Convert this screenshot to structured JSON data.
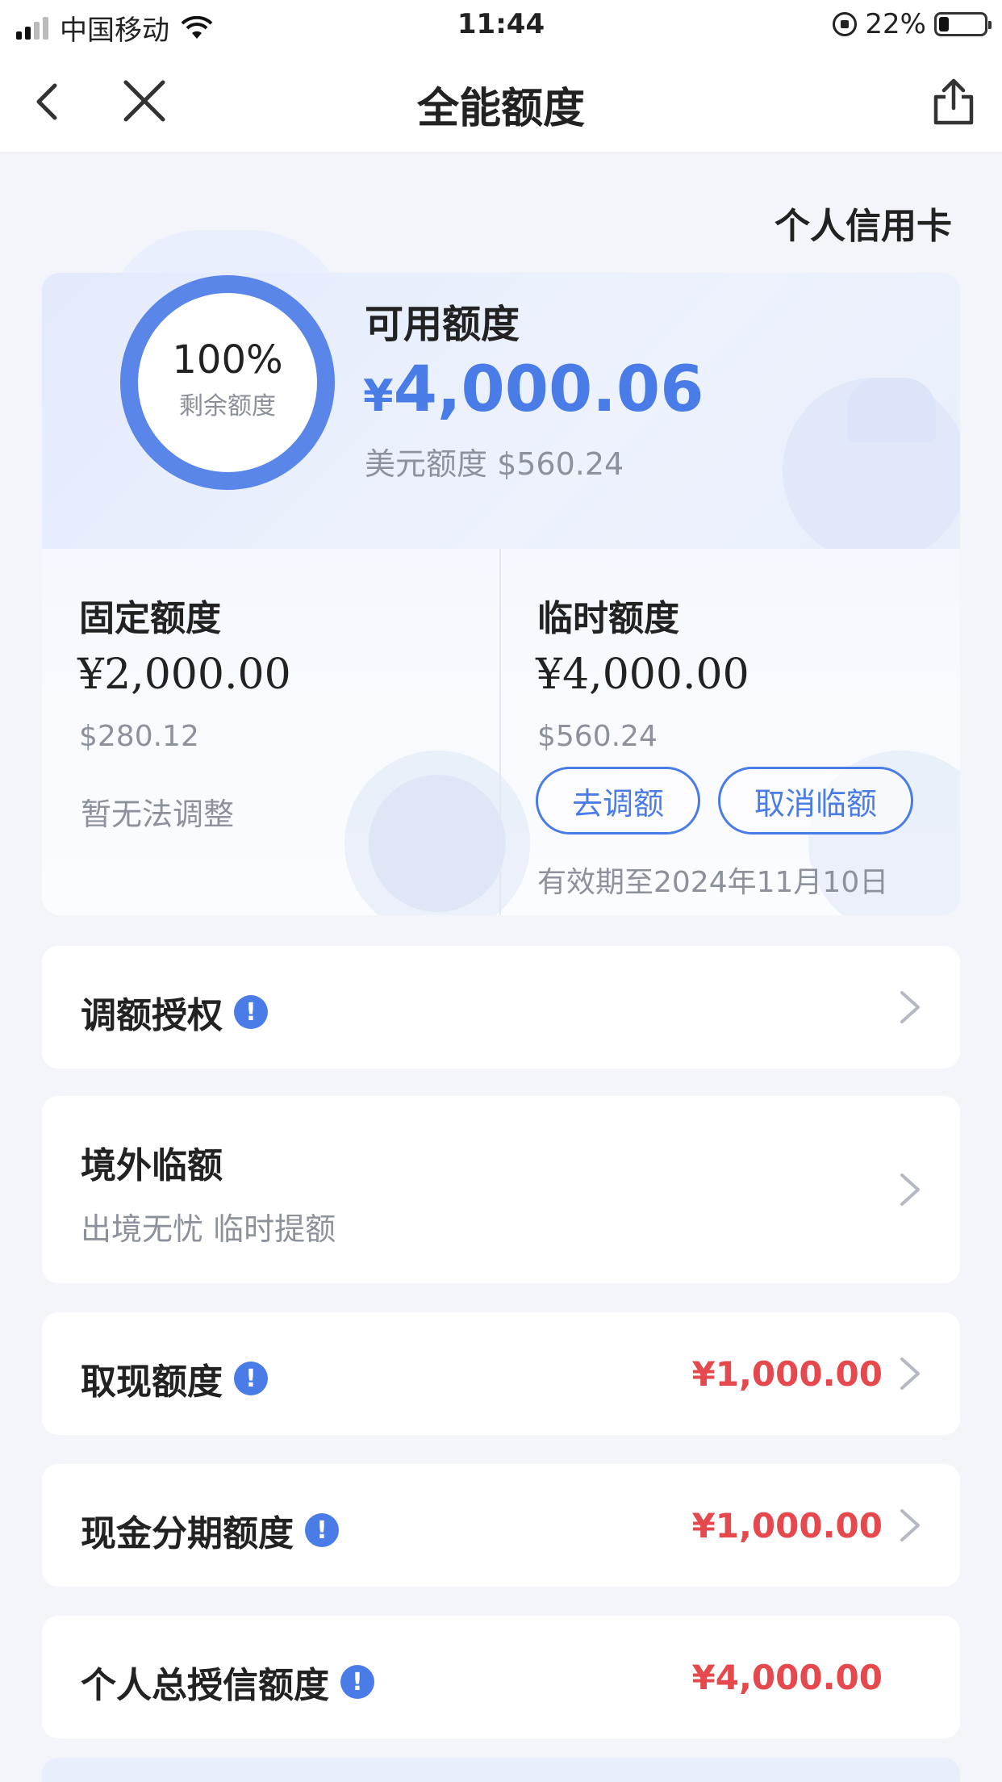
{
  "status_bar": {
    "carrier": "中国移动",
    "time": "11:44",
    "battery_percent": "22%",
    "battery_level": 0.22
  },
  "nav": {
    "title": "全能额度"
  },
  "account_type": "个人信用卡",
  "summary": {
    "ring_percent": "100%",
    "ring_fraction": 1.0,
    "ring_label": "剩余额度",
    "available_label": "可用额度",
    "available_currency": "¥",
    "available_amount": "4,000.06",
    "usd_label": "美元额度 $560.24",
    "fixed": {
      "title": "固定额度",
      "amount": "¥2,000.00",
      "usd": "$280.12",
      "note": "暂无法调整"
    },
    "temporary": {
      "title": "临时额度",
      "amount": "¥4,000.00",
      "usd": "$560.24",
      "adjust_button": "去调额",
      "cancel_button": "取消临额",
      "valid_until": "有效期至2024年11月10日"
    }
  },
  "rows": {
    "adjust_auth": {
      "title": "调额授权"
    },
    "overseas": {
      "title": "境外临额",
      "subtitle": "出境无忧 临时提额"
    },
    "cash_withdraw": {
      "title": "取现额度",
      "value": "¥1,000.00"
    },
    "cash_installment": {
      "title": "现金分期额度",
      "value": "¥1,000.00"
    },
    "total_credit": {
      "title": "个人总授信额度",
      "value": "¥4,000.00"
    }
  },
  "colors": {
    "accent": "#4a7ce8",
    "value_red": "#e5484d",
    "muted": "#8c919b"
  },
  "icons": [
    "signal-icon",
    "wifi-icon",
    "orientation-lock-icon",
    "battery-icon",
    "back-icon",
    "close-icon",
    "share-icon",
    "info-icon",
    "chevron-right-icon"
  ]
}
